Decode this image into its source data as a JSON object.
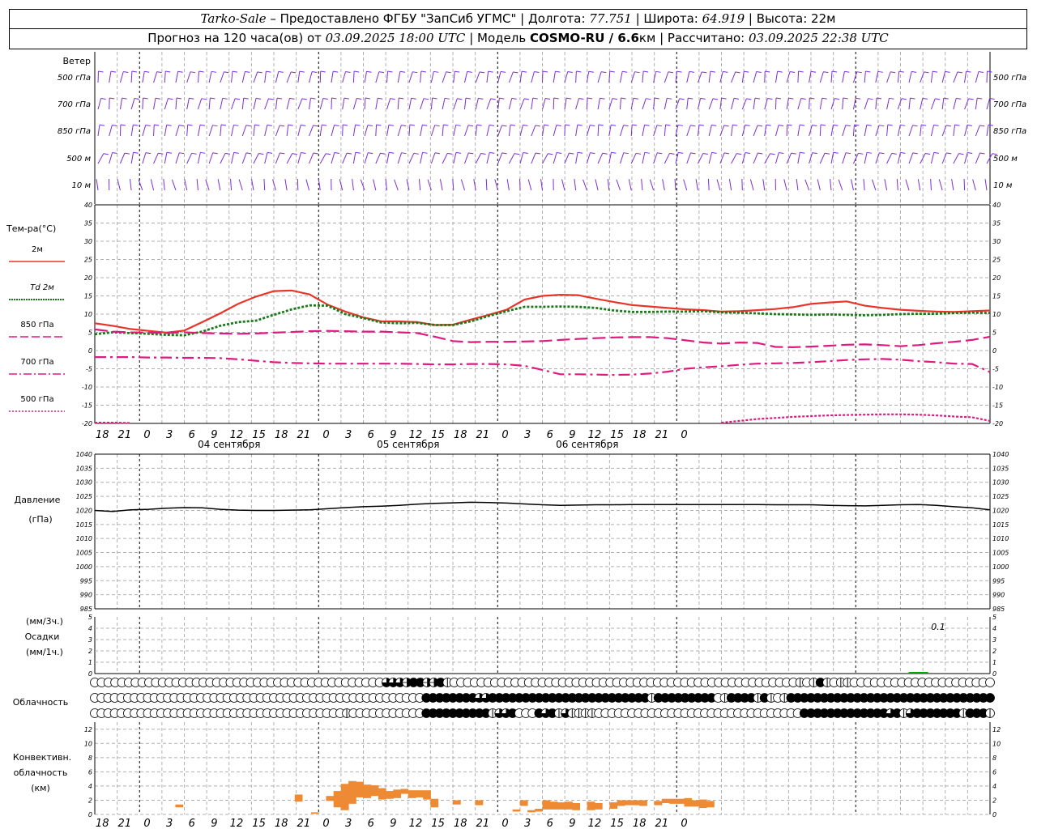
{
  "header": {
    "line1": {
      "station": "Tarko-Sale",
      "provider": " – Предоставлено ФГБУ \"ЗапСиб УГМС\" | Долгота: ",
      "lon": "77.751",
      "lat_label": " | Широта: ",
      "lat": "64.919",
      "alt_label": " | Высота: 22м"
    },
    "line2": {
      "forecast": "Прогноз на 120 часа(ов) от ",
      "issued": "03.09.2025 18:00 UTC",
      "model_label": " | Модель ",
      "model": "COSMO-RU / 6.6",
      "km": "км",
      "calc_label": " | Рассчитано: ",
      "calc": "03.09.2025 22:38 UTC"
    }
  },
  "colors": {
    "t2m": "#e8352a",
    "td2m": "#1a7a1a",
    "t850": "#e0197f",
    "t700": "#e0197f",
    "t500": "#e0197f",
    "pressure": "#000000",
    "precip": "#00aa00",
    "convective": "#ee8a33",
    "wind": "#7b2fd6",
    "grid": "#b0b0b0"
  },
  "x_axis": {
    "tick_labels": [
      "18",
      "21",
      "0",
      "3",
      "6",
      "9",
      "12",
      "15",
      "18",
      "21",
      "0",
      "3",
      "6",
      "9",
      "12",
      "15",
      "18",
      "21",
      "0",
      "3",
      "6",
      "9",
      "12",
      "15",
      "18",
      "21",
      "0"
    ],
    "day_labels": [
      "04 сентября",
      "05 сентября",
      "06 сентября"
    ]
  },
  "wind_panel": {
    "title": "Ветер",
    "levels": [
      "500 гПа",
      "700 гПа",
      "850 гПа",
      "500 м",
      "10 м"
    ],
    "right_levels": [
      "500 гПа",
      "700 гПа",
      "850 гПа",
      "500 м",
      "10 м"
    ]
  },
  "temp_panel": {
    "title": "Тем-ра(°C)",
    "legend": [
      "2м",
      "Td 2м",
      "850 гПа",
      "700 гПа",
      "500 гПа"
    ],
    "ticks": [
      "40",
      "35",
      "30",
      "25",
      "20",
      "15",
      "10",
      "5",
      "0",
      "-5",
      "-10",
      "-15",
      "-20"
    ]
  },
  "pressure_panel": {
    "title": "Давление",
    "unit": "(гПа)",
    "ticks": [
      "1040",
      "1035",
      "1030",
      "1025",
      "1020",
      "1015",
      "1010",
      "1005",
      "1000",
      "995",
      "990",
      "985"
    ]
  },
  "precip_panel": {
    "unit3": "(мм/3ч.)",
    "title": "Осадки",
    "unit1": "(мм/1ч.)",
    "ticks": [
      "5",
      "4",
      "3",
      "2",
      "1",
      "0"
    ],
    "max_label": "0.1"
  },
  "cloud_panel": {
    "title": "Облачность"
  },
  "conv_panel": {
    "title1": "Конвективн.",
    "title2": "облачность",
    "unit": "(км)",
    "ticks": [
      "12",
      "10",
      "8",
      "6",
      "4",
      "2",
      "0"
    ]
  },
  "chart_data": [
    {
      "type": "line",
      "name": "temperature",
      "x": [
        0,
        1,
        2,
        3,
        4,
        5,
        6,
        7,
        8,
        9,
        10,
        11,
        12,
        13,
        14,
        15,
        16,
        17,
        18,
        19,
        20,
        21,
        22,
        23,
        24,
        25,
        26,
        27,
        28,
        29,
        30,
        31,
        32,
        33,
        34,
        35,
        36,
        37,
        38,
        39,
        40
      ],
      "x_hours_from": "03.09.2025 18:00 UTC",
      "x_step_hours": 3,
      "ylim": [
        -20,
        40
      ],
      "series": [
        {
          "name": "2м",
          "values": [
            7.5,
            6.8,
            5.9,
            5.4,
            4.9,
            5.5,
            7.8,
            10.2,
            12.8,
            14.8,
            16.3,
            16.5,
            15.4,
            12.6,
            10.7,
            9.1,
            8.0,
            8.0,
            7.8,
            7.0,
            7.1,
            8.5,
            9.8,
            11.2,
            14.0,
            15.0,
            15.3,
            15.2,
            14.2,
            13.3,
            12.5,
            12.1,
            11.7,
            11.3,
            11.1,
            10.7,
            10.8,
            11.1,
            11.4,
            11.9,
            12.8,
            13.2,
            13.5,
            12.3,
            11.7,
            11.2,
            10.9,
            10.7,
            10.6,
            10.8,
            11.0
          ]
        },
        {
          "name": "Td 2м",
          "values": [
            4.5,
            5.0,
            4.8,
            4.6,
            4.3,
            4.2,
            5.2,
            6.8,
            7.8,
            8.2,
            9.8,
            11.3,
            12.4,
            12.3,
            10.0,
            8.9,
            7.7,
            7.5,
            7.6,
            7.0,
            7.0,
            8.0,
            9.5,
            10.8,
            12.0,
            12.0,
            12.1,
            12.0,
            11.7,
            11.0,
            10.6,
            10.6,
            10.7,
            10.7,
            10.8,
            10.5,
            10.4,
            10.2,
            10.0,
            9.9,
            9.8,
            9.9,
            9.8,
            9.7,
            9.8,
            10.0,
            10.1,
            10.1,
            10.3,
            10.4,
            10.3
          ]
        },
        {
          "name": "850 гПа",
          "values": [
            5.8,
            5.2,
            5.0,
            4.9,
            4.8,
            5.0,
            4.8,
            4.7,
            4.6,
            4.7,
            4.9,
            5.1,
            5.3,
            5.4,
            5.3,
            5.2,
            5.2,
            5.0,
            4.8,
            3.8,
            2.6,
            2.3,
            2.4,
            2.4,
            2.5,
            2.6,
            2.9,
            3.2,
            3.4,
            3.6,
            3.7,
            3.7,
            3.4,
            2.8,
            2.2,
            1.9,
            2.2,
            2.1,
            1.0,
            0.9,
            1.1,
            1.3,
            1.6,
            1.7,
            1.5,
            1.2,
            1.5,
            2.0,
            2.4,
            2.9,
            3.8
          ]
        },
        {
          "name": "700 гПа",
          "values": [
            -1.8,
            -1.8,
            -1.8,
            -1.9,
            -1.9,
            -2.0,
            -2.0,
            -2.1,
            -2.4,
            -2.8,
            -3.2,
            -3.4,
            -3.5,
            -3.6,
            -3.6,
            -3.6,
            -3.6,
            -3.6,
            -3.7,
            -3.8,
            -3.8,
            -3.7,
            -3.7,
            -3.8,
            -4.2,
            -5.3,
            -6.5,
            -6.5,
            -6.6,
            -6.7,
            -6.6,
            -6.3,
            -5.8,
            -5.0,
            -4.6,
            -4.3,
            -3.9,
            -3.6,
            -3.5,
            -3.4,
            -3.2,
            -2.9,
            -2.6,
            -2.4,
            -2.3,
            -2.5,
            -2.9,
            -3.2,
            -3.6,
            -3.7,
            -5.9
          ]
        },
        {
          "name": "500 гПа",
          "values": [
            -19.8,
            -19.8,
            -19.9,
            null,
            null,
            null,
            null,
            null,
            null,
            null,
            null,
            null,
            null,
            null,
            null,
            null,
            null,
            null,
            null,
            null,
            null,
            null,
            null,
            null,
            null,
            null,
            null,
            null,
            null,
            null,
            null,
            null,
            null,
            null,
            null,
            -19.8,
            -19.3,
            -18.8,
            -18.5,
            -18.2,
            -18.0,
            -17.8,
            -17.7,
            -17.6,
            -17.5,
            -17.5,
            -17.6,
            -17.8,
            -18.1,
            -18.3,
            -19.3
          ]
        }
      ]
    },
    {
      "type": "line",
      "name": "pressure",
      "ylim": [
        985,
        1040
      ],
      "series": [
        {
          "name": "Давление",
          "values": [
            1020.0,
            1019.6,
            1020.2,
            1020.4,
            1020.8,
            1021.0,
            1020.9,
            1020.4,
            1020.1,
            1020.0,
            1020.0,
            1020.1,
            1020.2,
            1020.6,
            1021.0,
            1021.3,
            1021.5,
            1021.8,
            1022.2,
            1022.5,
            1022.7,
            1022.9,
            1022.8,
            1022.6,
            1022.3,
            1022.0,
            1021.8,
            1021.9,
            1022.0,
            1022.0,
            1022.1,
            1022.1,
            1022.1,
            1022.1,
            1022.1,
            1022.1,
            1022.1,
            1022.1,
            1022.0,
            1022.0,
            1022.0,
            1021.8,
            1021.7,
            1021.6,
            1021.8,
            1022.0,
            1022.1,
            1021.8,
            1021.3,
            1020.9,
            1020.2
          ]
        }
      ]
    },
    {
      "type": "bar",
      "name": "precipitation",
      "ylim": [
        0,
        5
      ],
      "series": [
        {
          "name": "Осадки",
          "values": [
            0,
            0,
            0,
            0,
            0,
            0,
            0,
            0,
            0,
            0,
            0,
            0,
            0,
            0,
            0,
            0,
            0,
            0,
            0,
            0,
            0,
            0,
            0,
            0,
            0,
            0,
            0,
            0,
            0,
            0,
            0,
            0,
            0,
            0,
            0,
            0,
            0,
            0,
            0,
            0,
            0,
            0,
            0,
            0,
            0,
            0,
            0.1,
            0,
            0,
            0,
            0
          ]
        }
      ]
    },
    {
      "type": "bar",
      "name": "convective_cloud",
      "ylim": [
        0,
        13
      ],
      "segments_km": [
        {
          "h": 11.3,
          "bottom": 1.0,
          "top": 1.4
        },
        {
          "h": 27.3,
          "bottom": 1.8,
          "top": 2.8
        },
        {
          "h": 29.5,
          "bottom": 0.1,
          "top": 0.3
        },
        {
          "h": 31.5,
          "bottom": 1.9,
          "top": 2.6
        },
        {
          "h": 32.5,
          "bottom": 1.0,
          "top": 3.3
        },
        {
          "h": 33.5,
          "bottom": 0.6,
          "top": 4.3
        },
        {
          "h": 34.5,
          "bottom": 1.5,
          "top": 4.7
        },
        {
          "h": 35.5,
          "bottom": 2.4,
          "top": 4.6
        },
        {
          "h": 36.5,
          "bottom": 2.3,
          "top": 4.2
        },
        {
          "h": 37.5,
          "bottom": 2.6,
          "top": 4.1
        },
        {
          "h": 38.5,
          "bottom": 2.1,
          "top": 3.7
        },
        {
          "h": 39.5,
          "bottom": 2.2,
          "top": 3.3
        },
        {
          "h": 40.5,
          "bottom": 2.3,
          "top": 3.5
        },
        {
          "h": 41.5,
          "bottom": 2.9,
          "top": 3.6
        },
        {
          "h": 42.5,
          "bottom": 2.3,
          "top": 3.4
        },
        {
          "h": 43.5,
          "bottom": 2.4,
          "top": 3.4
        },
        {
          "h": 44.5,
          "bottom": 2.1,
          "top": 3.4
        },
        {
          "h": 45.5,
          "bottom": 1.0,
          "top": 2.2
        },
        {
          "h": 48.5,
          "bottom": 1.4,
          "top": 2.0
        },
        {
          "h": 51.5,
          "bottom": 1.3,
          "top": 2.0
        },
        {
          "h": 56.5,
          "bottom": 0.4,
          "top": 0.7
        },
        {
          "h": 57.5,
          "bottom": 1.2,
          "top": 2.0
        },
        {
          "h": 58.5,
          "bottom": 0.3,
          "top": 0.6
        },
        {
          "h": 59.5,
          "bottom": 0.4,
          "top": 0.8
        },
        {
          "h": 60.5,
          "bottom": 0.7,
          "top": 2.0
        },
        {
          "h": 61.5,
          "bottom": 0.7,
          "top": 1.8
        },
        {
          "h": 62.5,
          "bottom": 0.7,
          "top": 1.7
        },
        {
          "h": 63.5,
          "bottom": 0.7,
          "top": 1.8
        },
        {
          "h": 64.5,
          "bottom": 0.6,
          "top": 1.6
        },
        {
          "h": 66.5,
          "bottom": 0.6,
          "top": 1.8
        },
        {
          "h": 67.5,
          "bottom": 0.7,
          "top": 1.6
        },
        {
          "h": 69.5,
          "bottom": 0.8,
          "top": 1.7
        },
        {
          "h": 70.5,
          "bottom": 1.2,
          "top": 2.0
        },
        {
          "h": 71.5,
          "bottom": 1.3,
          "top": 2.0
        },
        {
          "h": 72.5,
          "bottom": 1.3,
          "top": 2.0
        },
        {
          "h": 73.5,
          "bottom": 1.2,
          "top": 2.0
        },
        {
          "h": 75.5,
          "bottom": 1.3,
          "top": 1.9
        },
        {
          "h": 76.5,
          "bottom": 1.6,
          "top": 2.2
        },
        {
          "h": 77.5,
          "bottom": 1.5,
          "top": 2.2
        },
        {
          "h": 78.5,
          "bottom": 1.5,
          "top": 2.2
        },
        {
          "h": 79.5,
          "bottom": 1.1,
          "top": 2.3
        },
        {
          "h": 80.5,
          "bottom": 1.1,
          "top": 2.0
        },
        {
          "h": 81.5,
          "bottom": 0.9,
          "top": 2.1
        },
        {
          "h": 82.5,
          "bottom": 1.0,
          "top": 1.9
        }
      ]
    }
  ],
  "cloud_rows": [
    "0000000000000000000000000000000000000000000666588558400000000000000000000000000000000000000000000000000040484044000000000000000000000",
    "0000000000000000000000000000000000000000000000000088888888668888888888888888888888884888888888048888484048888888888888888888888888888888",
    "0000000000000000000000000000000000000040000000000088888888884668000868464444000000000000000000000000000000088888888888886846888888848884"
  ]
}
